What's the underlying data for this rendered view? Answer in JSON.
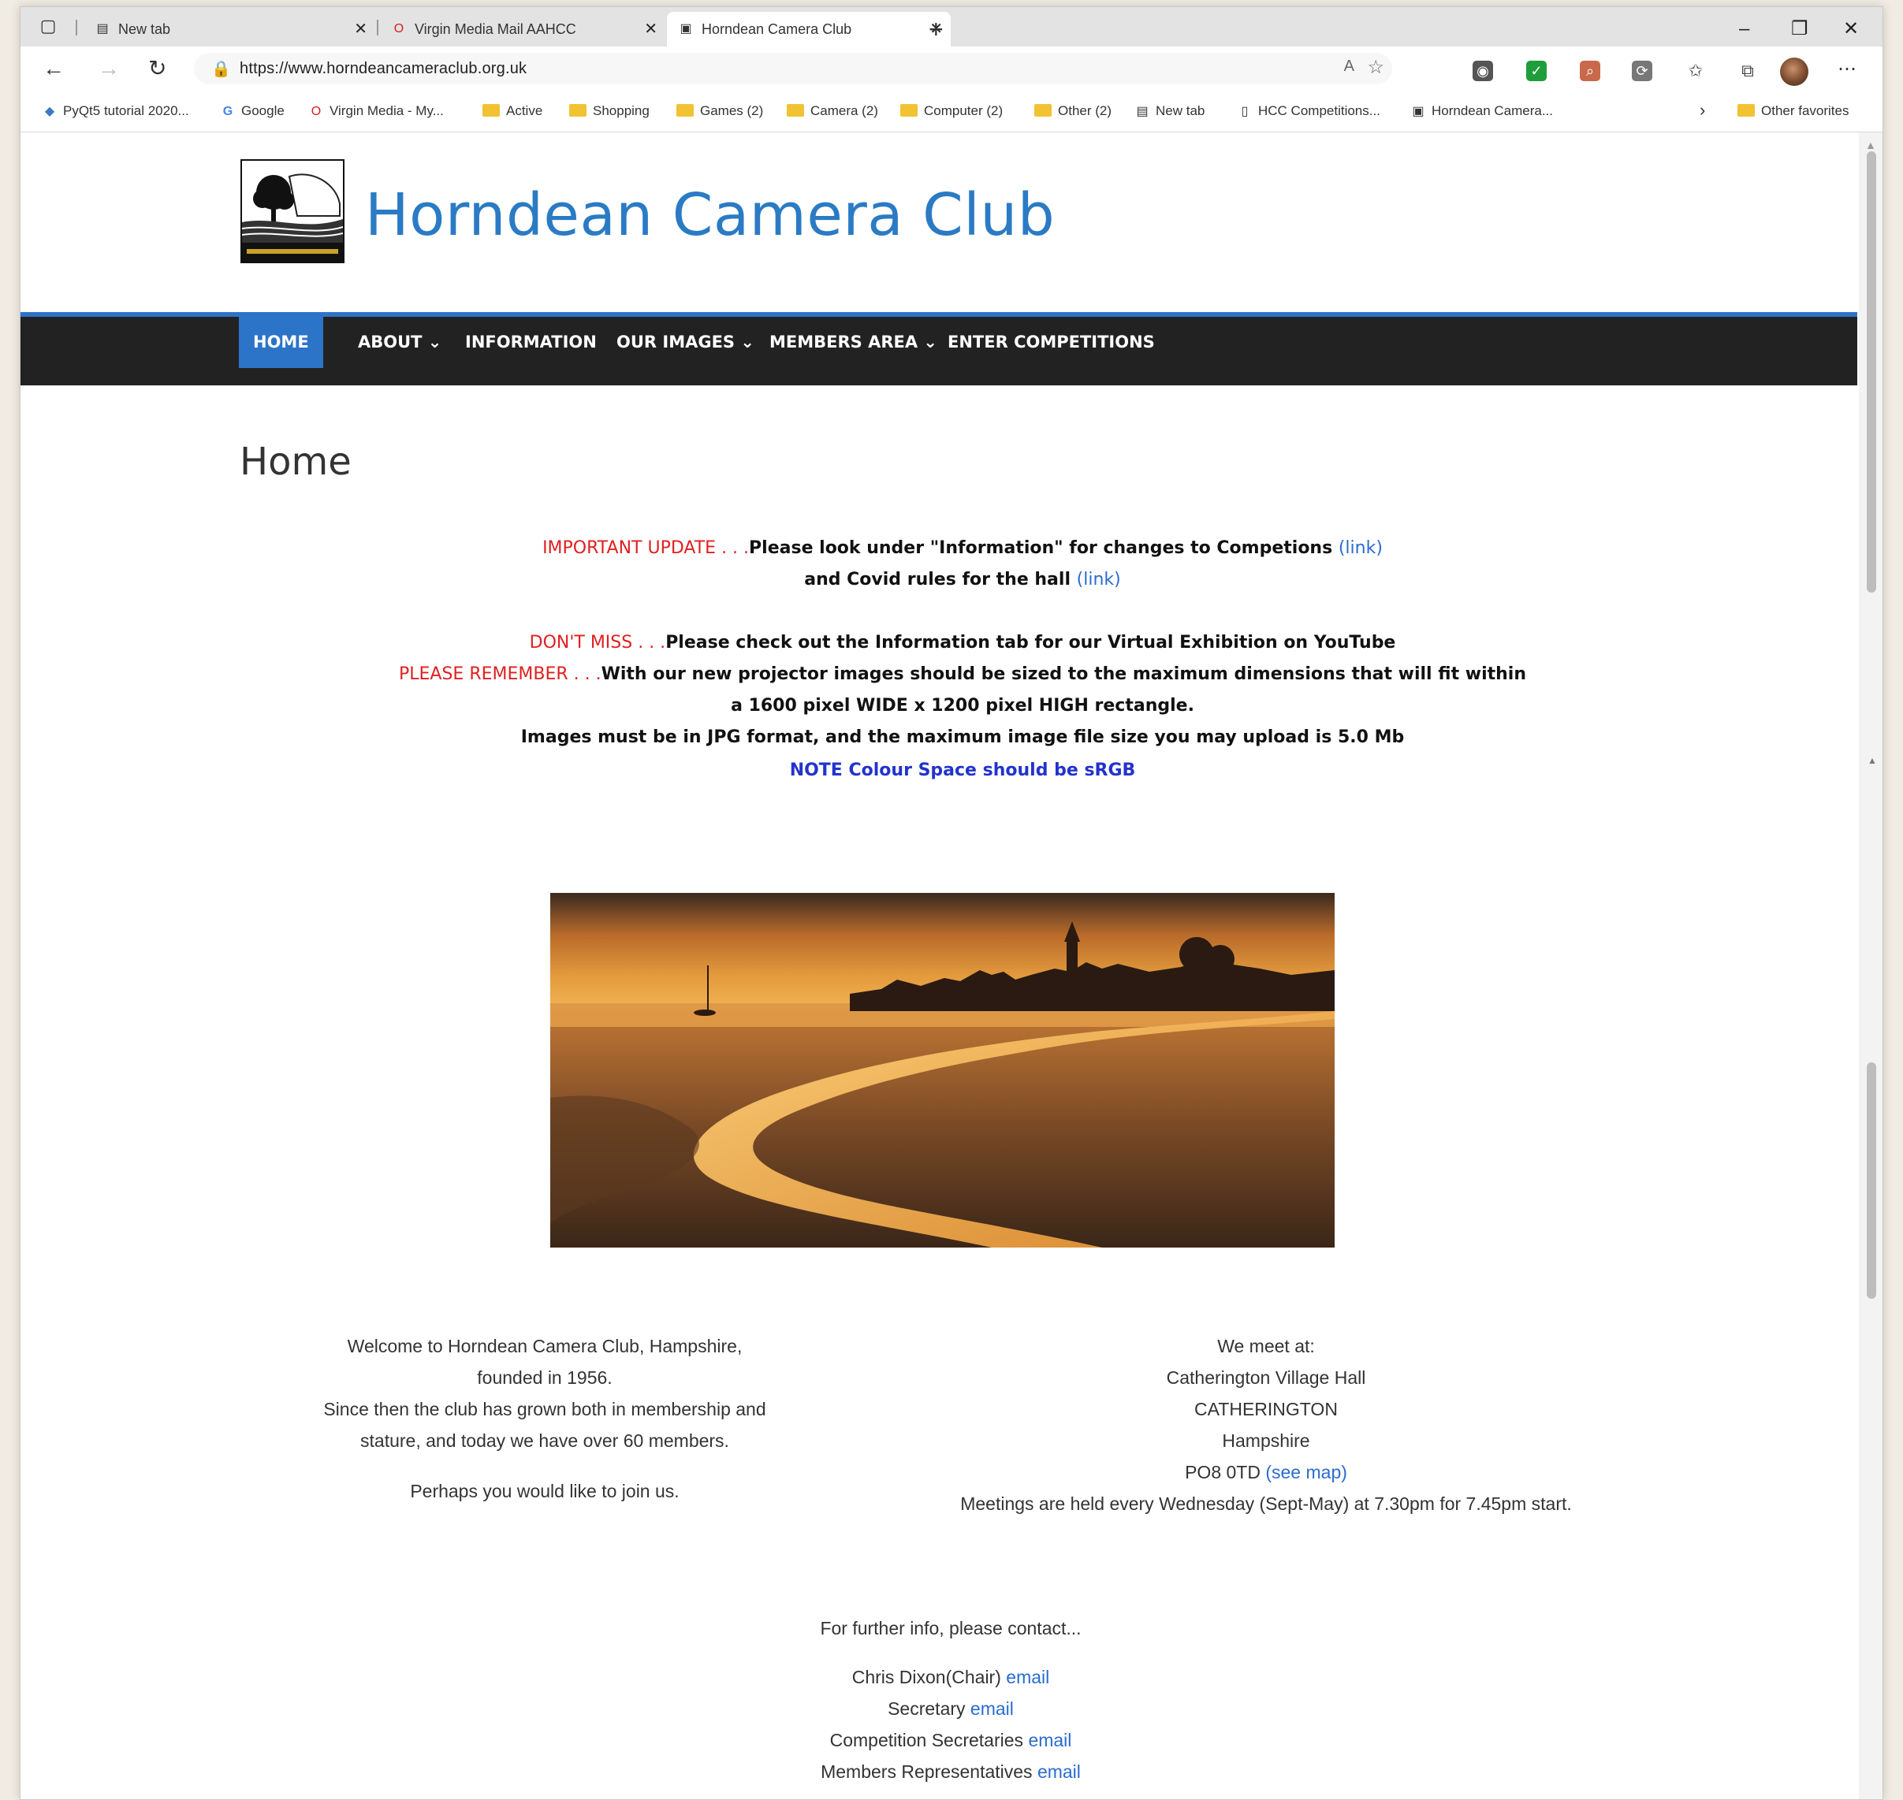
{
  "browser": {
    "tabs": [
      {
        "label": "New tab",
        "icon": "newtab-icon"
      },
      {
        "label": "Virgin Media Mail AAHCC",
        "icon": "virgin-media-icon"
      },
      {
        "label": "Horndean Camera Club",
        "icon": "camera-club-icon",
        "active": true
      }
    ],
    "url": "https://www.horndeancameraclub.org.uk",
    "bookmarks": [
      {
        "label": "PyQt5 tutorial 2020...",
        "icon": "python-icon"
      },
      {
        "label": "Google",
        "icon": "google-icon"
      },
      {
        "label": "Virgin Media - My...",
        "icon": "virgin-media-icon"
      },
      {
        "label": "Active",
        "icon": "folder-icon"
      },
      {
        "label": "Shopping",
        "icon": "folder-icon"
      },
      {
        "label": "Games (2)",
        "icon": "folder-icon"
      },
      {
        "label": "Camera (2)",
        "icon": "folder-icon"
      },
      {
        "label": "Computer (2)",
        "icon": "folder-icon"
      },
      {
        "label": "Other (2)",
        "icon": "folder-icon"
      },
      {
        "label": "New tab",
        "icon": "newtab-icon"
      },
      {
        "label": "HCC Competitions...",
        "icon": "page-icon"
      },
      {
        "label": "Horndean Camera...",
        "icon": "camera-club-icon"
      }
    ],
    "other_favorites": "Other favorites"
  },
  "site": {
    "title": "Horndean Camera Club",
    "accent": "#2c74c8",
    "nav": [
      {
        "label": "HOME",
        "active": true
      },
      {
        "label": "ABOUT ⌄"
      },
      {
        "label": "INFORMATION"
      },
      {
        "label": "OUR IMAGES ⌄"
      },
      {
        "label": "MEMBERS AREA ⌄"
      },
      {
        "label": "ENTER COMPETITIONS"
      }
    ]
  },
  "content": {
    "heading": "Home",
    "notice1_prefix": "IMPORTANT UPDATE . . .",
    "notice1_text": "Please look under \"Information\" for changes to Competions ",
    "notice1_link": "(link)",
    "notice2_text": "and Covid rules for the hall ",
    "notice2_link": "(link)",
    "notice3_prefix": "DON'T MISS . . .",
    "notice3_text": "Please check out the Information tab for our Virtual Exhibition on YouTube",
    "notice4_prefix": "PLEASE REMEMBER . . .",
    "notice4_text": "With our new projector images should be sized to the maximum dimensions that will fit within",
    "notice5_text": "a 1600 pixel WIDE x 1200 pixel HIGH rectangle.",
    "notice6_text": "Images must be in JPG format, and the maximum image file size you may upload is 5.0 Mb",
    "notice7_text": "NOTE Colour Space should be sRGB",
    "welcome": [
      "Welcome to Horndean Camera Club, Hampshire,",
      "founded in 1956.",
      "Since then the club has grown both in membership and",
      "stature, and today we have over 60 members."
    ],
    "join": "Perhaps you would like to join us.",
    "meet_title": "We meet at:",
    "meet_lines": [
      "Catherington Village Hall",
      "CATHERINGTON",
      "Hampshire"
    ],
    "postcode": "PO8 0TD ",
    "map_link": "(see map)",
    "meetings": "Meetings are held every Wednesday (Sept-May) at 7.30pm for 7.45pm start.",
    "contact_intro": "For further info, please contact...",
    "contacts": [
      {
        "role": "Chris Dixon(Chair) ",
        "link": "email"
      },
      {
        "role": "Secretary ",
        "link": "email"
      },
      {
        "role": "Competition Secretaries ",
        "link": "email"
      },
      {
        "role": "Members Representatives ",
        "link": "email"
      }
    ]
  }
}
